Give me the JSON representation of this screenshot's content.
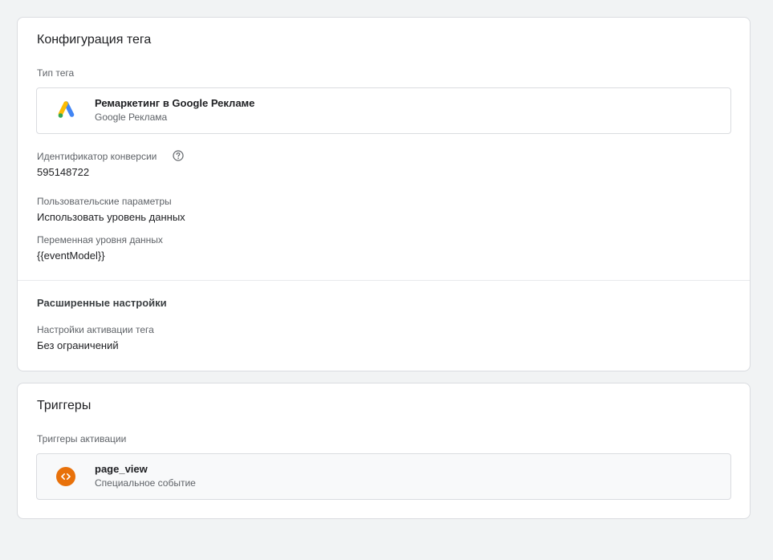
{
  "config": {
    "title": "Конфигурация тега",
    "tag_type_label": "Тип тега",
    "tag_type_name": "Ремаркетинг в Google Рекламе",
    "tag_type_vendor": "Google Реклама",
    "conversion_id_label": "Идентификатор конверсии",
    "conversion_id_value": "595148722",
    "custom_params_label": "Пользовательские параметры",
    "custom_params_value": "Использовать уровень данных",
    "datalayer_var_label": "Переменная уровня данных",
    "datalayer_var_value": "{{eventModel}}",
    "advanced_title": "Расширенные настройки",
    "firing_options_label": "Настройки активации тега",
    "firing_options_value": "Без ограничений"
  },
  "triggers": {
    "title": "Триггеры",
    "firing_label": "Триггеры активации",
    "items": [
      {
        "name": "page_view",
        "type": "Специальное событие"
      }
    ]
  },
  "icons": {
    "tag_type": "google-ads-icon",
    "help": "help-icon",
    "trigger": "custom-event-icon"
  },
  "colors": {
    "trigger_icon": "#e8710a",
    "ads_blue": "#4285f4",
    "ads_yellow": "#fbbc04",
    "ads_green": "#34a853"
  }
}
